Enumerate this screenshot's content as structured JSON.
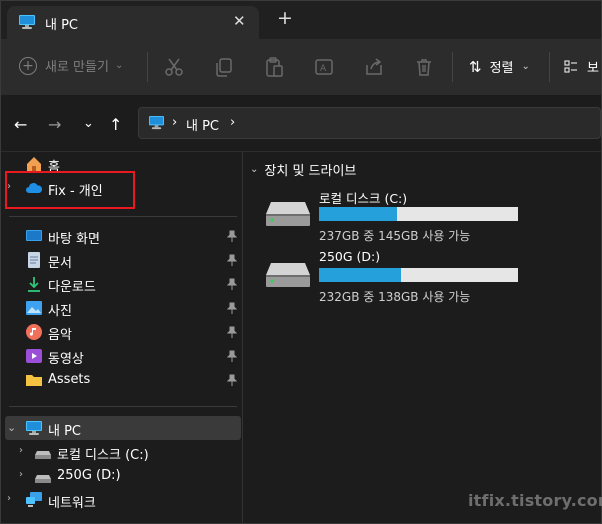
{
  "tab": {
    "title": "내 PC",
    "close_glyph": "✕",
    "new_glyph": "+"
  },
  "commandbar": {
    "new_label": "새로 만들기",
    "sort_label": "정렬",
    "view_label": "보"
  },
  "address": {
    "crumb": "내 PC",
    "sep": "›"
  },
  "sidebar": {
    "home": "홈",
    "onedrive": "Fix - 개인",
    "quick": [
      {
        "label": "바탕 화면",
        "icon": "desktop-icon"
      },
      {
        "label": "문서",
        "icon": "document-icon"
      },
      {
        "label": "다운로드",
        "icon": "download-icon"
      },
      {
        "label": "사진",
        "icon": "pictures-icon"
      },
      {
        "label": "음악",
        "icon": "music-icon"
      },
      {
        "label": "동영상",
        "icon": "video-icon"
      },
      {
        "label": "Assets",
        "icon": "folder-icon"
      }
    ],
    "thispc": "내 PC",
    "drives": [
      "로컬 디스크 (C:)",
      "250G (D:)"
    ],
    "network": "네트워크"
  },
  "main": {
    "group_header": "장치 및 드라이브",
    "drives": [
      {
        "name": "로컬 디스크 (C:)",
        "info": "237GB 중 145GB 사용 가능",
        "used_fraction": 0.39
      },
      {
        "name": "250G (D:)",
        "info": "232GB 중 138GB 사용 가능",
        "used_fraction": 0.41
      }
    ]
  },
  "watermark": "itfix.tistory.com",
  "colors": {
    "accent": "#26a0da",
    "highlight": "#e8191f"
  }
}
